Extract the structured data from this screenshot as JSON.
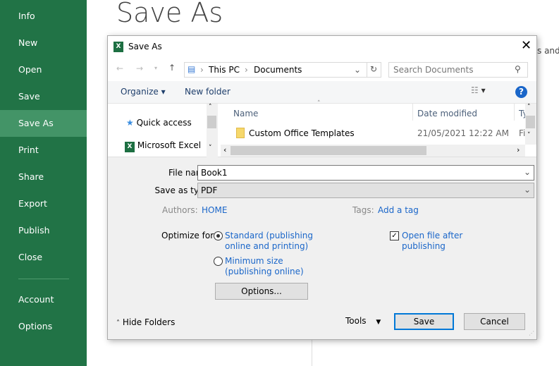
{
  "sidebar": {
    "items": [
      {
        "label": "Info"
      },
      {
        "label": "New"
      },
      {
        "label": "Open"
      },
      {
        "label": "Save"
      },
      {
        "label": "Save As"
      },
      {
        "label": "Print"
      },
      {
        "label": "Share"
      },
      {
        "label": "Export"
      },
      {
        "label": "Publish"
      },
      {
        "label": "Close"
      },
      {
        "label": "Account"
      },
      {
        "label": "Options"
      }
    ],
    "selected": "Save As",
    "bg_color": "#217346",
    "selected_color": "#439467"
  },
  "page": {
    "title": "Save As",
    "background_text": "s and l"
  },
  "dialog": {
    "title": "Save As",
    "breadcrumb": [
      "This PC",
      "Documents"
    ],
    "search_placeholder": "Search Documents",
    "toolbar": {
      "organize": "Organize",
      "new_folder": "New folder"
    },
    "nav_pane": [
      {
        "label": "Quick access",
        "icon": "star-icon"
      },
      {
        "label": "Microsoft Excel",
        "icon": "excel-icon"
      }
    ],
    "columns": [
      "Name",
      "Date modified",
      "Ty"
    ],
    "files": [
      {
        "name": "Custom Office Templates",
        "date": "21/05/2021 12:22 AM",
        "type": "Fi"
      }
    ],
    "file_name_label": "File name:",
    "file_name": "Book1",
    "save_type_label": "Save as type:",
    "save_type": "PDF",
    "authors_label": "Authors:",
    "authors": "HOME",
    "tags_label": "Tags:",
    "tags": "Add a tag",
    "optimize_label": "Optimize for:",
    "optimize_options": [
      {
        "line1": "Standard (publishing",
        "line2": "online and printing)",
        "selected": true
      },
      {
        "line1": "Minimum size",
        "line2": "(publishing online)",
        "selected": false
      }
    ],
    "open_after": {
      "line1": "Open file after",
      "line2": "publishing",
      "checked": true
    },
    "options_button": "Options...",
    "hide_folders": "Hide Folders",
    "tools": "Tools",
    "save": "Save",
    "cancel": "Cancel"
  }
}
